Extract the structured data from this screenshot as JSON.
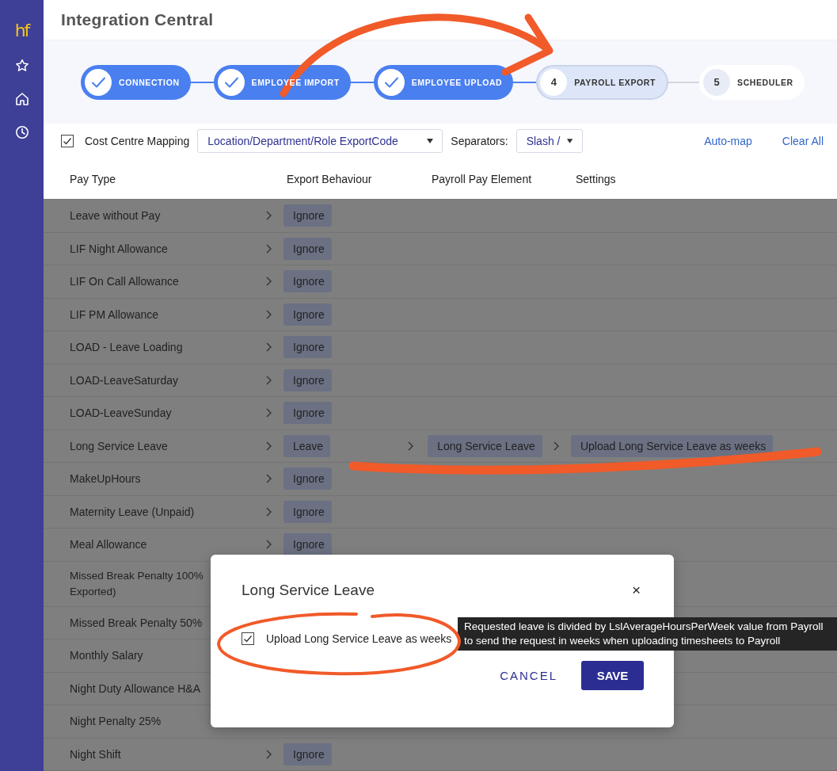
{
  "sidebar": {
    "logo": "hf",
    "items": [
      {
        "kind": "star"
      },
      {
        "kind": "home"
      },
      {
        "kind": "clock"
      }
    ]
  },
  "header": {
    "title": "Integration Central"
  },
  "steps": [
    {
      "label": "CONNECTION",
      "completed": true,
      "selected": false
    },
    {
      "label": "EMPLOYEE IMPORT",
      "completed": true,
      "selected": false
    },
    {
      "label": "EMPLOYEE UPLOAD",
      "completed": true,
      "selected": false
    },
    {
      "number": "4",
      "label": "PAYROLL EXPORT",
      "completed": false,
      "selected": true
    },
    {
      "number": "5",
      "label": "SCHEDULER",
      "completed": false,
      "selected": false
    }
  ],
  "toolbar": {
    "mapping_checked": true,
    "mapping_label": "Cost Centre Mapping",
    "mapping_value": "Location/Department/Role ExportCode",
    "separators_label": "Separators:",
    "separators_value": "Slash /",
    "links": [
      "Auto-map",
      "Clear All"
    ]
  },
  "columns": [
    "Pay Type",
    "Export Behaviour",
    "Payroll Pay Element",
    "Settings"
  ],
  "rows": [
    {
      "name": "Leave without Pay",
      "behaviour": "Ignore"
    },
    {
      "name": "LIF Night Allowance",
      "behaviour": "Ignore"
    },
    {
      "name": "LIF On Call Allowance",
      "behaviour": "Ignore"
    },
    {
      "name": "LIF PM Allowance",
      "behaviour": "Ignore"
    },
    {
      "name": "LOAD - Leave Loading",
      "behaviour": "Ignore"
    },
    {
      "name": "LOAD-LeaveSaturday",
      "behaviour": "Ignore"
    },
    {
      "name": "LOAD-LeaveSunday",
      "behaviour": "Ignore"
    },
    {
      "name": "Long Service Leave",
      "behaviour": "Leave",
      "pay_element": "Long Service Leave",
      "setting": "Upload Long Service Leave as weeks"
    },
    {
      "name": "MakeUpHours",
      "behaviour": "Ignore"
    },
    {
      "name": "Maternity Leave (Unpaid)",
      "behaviour": "Ignore"
    },
    {
      "name": "Meal Allowance",
      "behaviour": "Ignore"
    },
    {
      "name": "Missed Break Penalty 100%\nExported)"
    },
    {
      "name": "Missed Break Penalty 50%"
    },
    {
      "name": "Monthly Salary"
    },
    {
      "name": "Night Duty Allowance H&A"
    },
    {
      "name": "Night Penalty 25%"
    },
    {
      "name": "Night Shift",
      "behaviour": "Ignore"
    }
  ],
  "modal": {
    "title": "Long Service Leave",
    "close": "×",
    "checked": true,
    "option": "Upload Long Service Leave as weeks",
    "tooltip": [
      "Requested leave is divided by LslAverageHoursPerWeek value from Payroll",
      "to send the request in weeks when uploading timesheets to Payroll"
    ],
    "buttons": [
      "CANCEL",
      "SAVE"
    ]
  },
  "annotations": [
    {
      "kind": "arrow"
    },
    {
      "kind": "underline"
    },
    {
      "kind": "ellipse"
    }
  ]
}
